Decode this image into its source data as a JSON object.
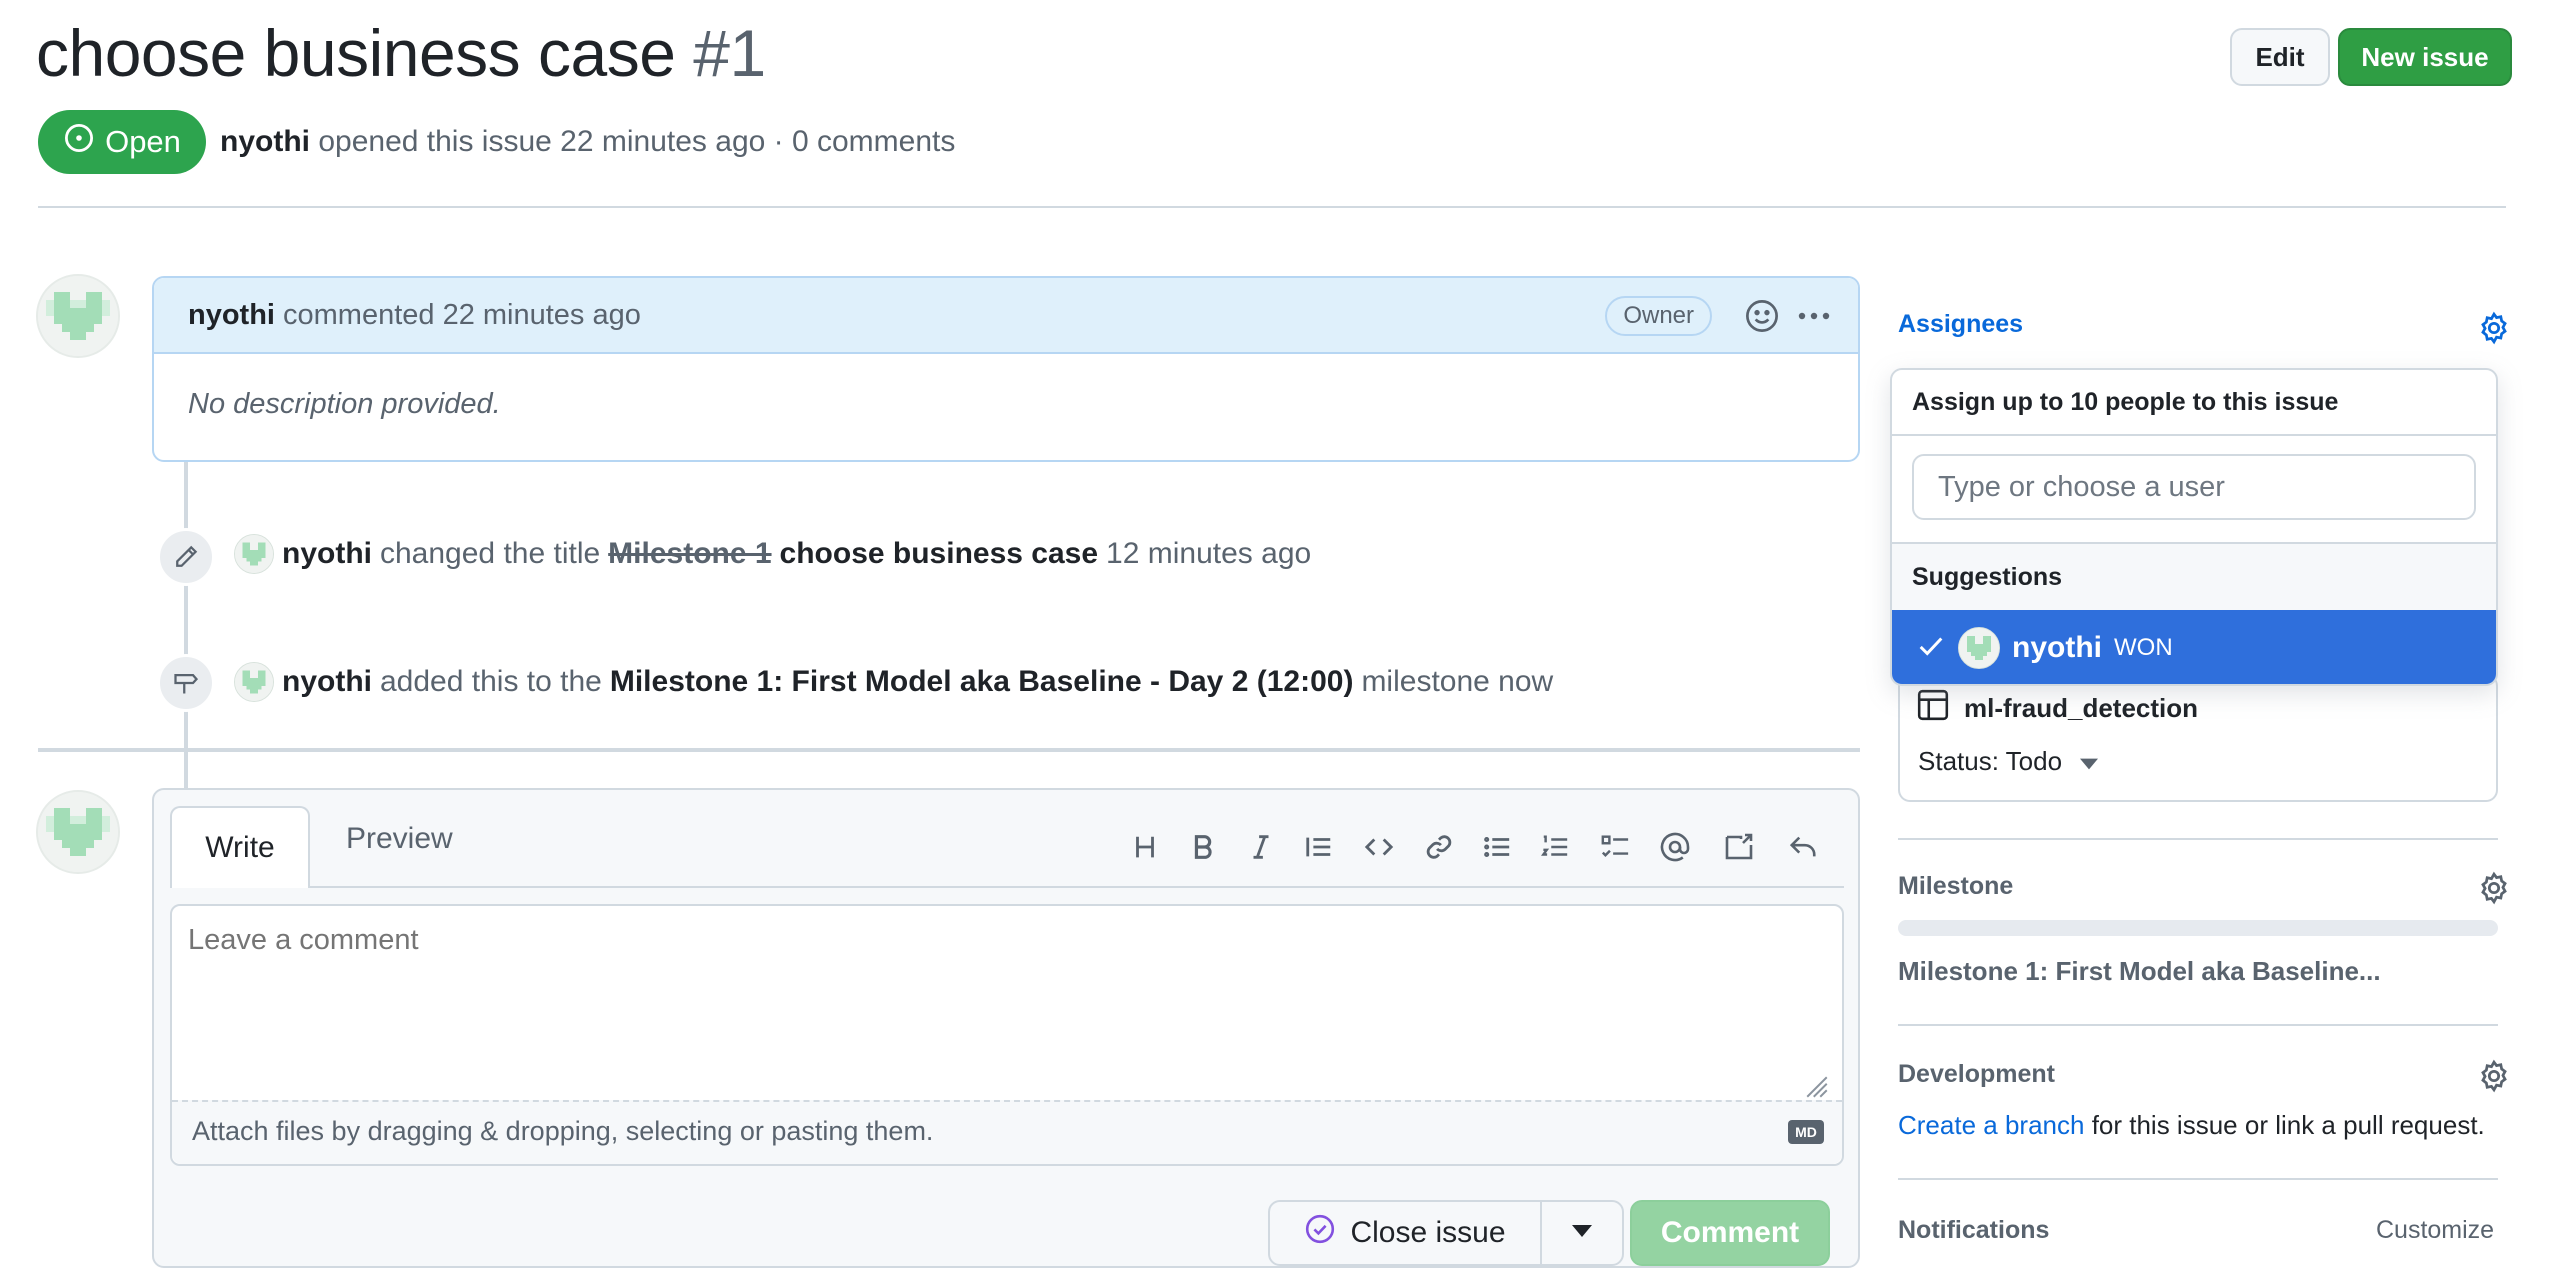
{
  "issue": {
    "title": "choose business case",
    "number": "#1",
    "state": "Open",
    "author": "nyothi",
    "opened_text": "opened this issue 22 minutes ago · 0 comments"
  },
  "header_actions": {
    "edit": "Edit",
    "new_issue": "New issue"
  },
  "comment": {
    "author": "nyothi",
    "action_text": "commented 22 minutes ago",
    "role": "Owner",
    "body": "No description provided."
  },
  "events": [
    {
      "icon": "pencil-icon",
      "actor": "nyothi",
      "verb": "changed the title",
      "old_title": "Milestone 1",
      "new_title": "choose business case",
      "when": "12 minutes ago"
    },
    {
      "icon": "milestone-icon",
      "actor": "nyothi",
      "verb": "added this to the",
      "target": "Milestone 1: First Model aka Baseline - Day 2 (12:00)",
      "suffix": "milestone now"
    }
  ],
  "composer": {
    "tabs": [
      "Write",
      "Preview"
    ],
    "toolbar": [
      "heading-icon",
      "bold-icon",
      "italic-icon",
      "quote-icon",
      "code-icon",
      "link-icon",
      "unordered-list-icon",
      "ordered-list-icon",
      "task-list-icon",
      "mention-icon",
      "cross-reference-icon",
      "reply-icon"
    ],
    "placeholder": "Leave a comment",
    "attach_text": "Attach files by dragging & dropping, selecting or pasting them.",
    "markdown_badge": "MD",
    "close_label": "Close issue",
    "comment_label": "Comment"
  },
  "sidebar": {
    "assignees_label": "Assignees",
    "project": {
      "name": "ml-fraud_detection",
      "status": "Status: Todo"
    },
    "milestone_label": "Milestone",
    "milestone_progress": 0,
    "milestone_name": "Milestone 1: First Model aka Baseline...",
    "development_label": "Development",
    "development_link": "Create a branch",
    "development_text": "for this issue or link a pull request.",
    "notifications_label": "Notifications",
    "customize": "Customize"
  },
  "assignee_popover": {
    "header": "Assign up to 10 people to this issue",
    "search_placeholder": "Type or choose a user",
    "section": "Suggestions",
    "suggestions": [
      {
        "username": "nyothi",
        "fullname": "WON",
        "selected": true
      }
    ]
  },
  "colors": {
    "open_green": "#2da44e",
    "link_blue": "#0969da",
    "selected_row": "#2f6fdc",
    "comment_header": "#dff0fb"
  }
}
